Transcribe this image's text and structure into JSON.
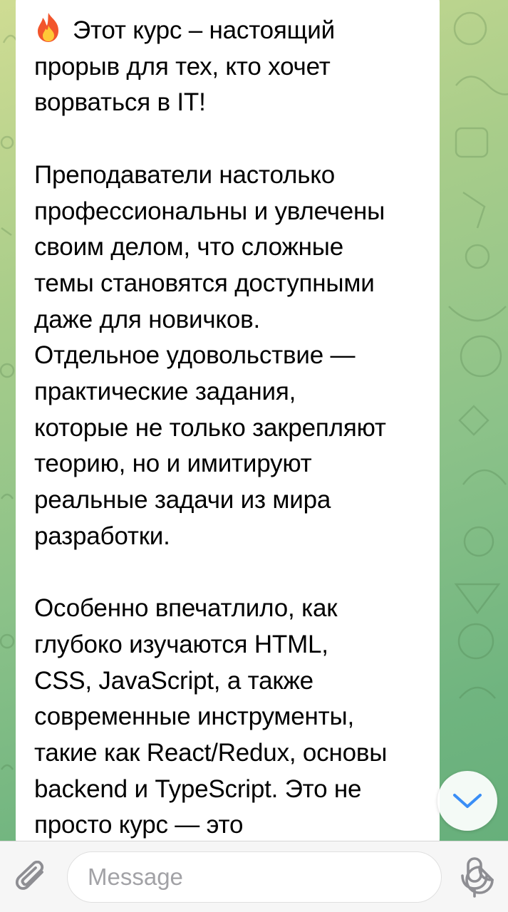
{
  "message": {
    "text": "Этот курс – настоящий\nпрорыв для тех, кто хочет\nворваться в IT!\n\nПреподаватели настолько\nпрофессиональны и увлечены\nсвоим делом, что сложные\nтемы становятся доступными\nдаже для новичков.\nОтдельное удовольствие —\nпрактические задания,\nкоторые не только закрепляют\nтеорию, но и имитируют\nреальные задачи из мира\nразработки.\n\nОсобенно впечатлило, как\nглубоко изучаются HTML,\nCSS, JavaScript, а также\nсовременные инструменты,\nтакие как React/Redux, основы\nbackend и TypeScript. Это не\nпросто курс — это"
  },
  "input_bar": {
    "placeholder": "Message"
  },
  "icons": {
    "emoji": "fire-icon",
    "attach": "paperclip-icon",
    "sticker": "sticker-icon",
    "mic": "microphone-icon",
    "scroll": "chevron-down-icon"
  },
  "colors": {
    "accent": "#3a8ef6",
    "icon_gray": "#8e8e93",
    "bubble": "#ffffff",
    "bar": "#f6f6f6",
    "bg_top": "#cfdc93",
    "bg_bottom": "#63ad79"
  }
}
